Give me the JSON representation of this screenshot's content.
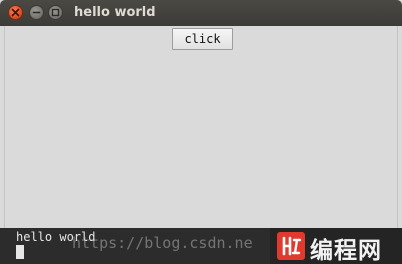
{
  "window": {
    "title": "hello world",
    "controls": {
      "close_icon": "close-icon",
      "minimize_icon": "minimize-icon",
      "maximize_icon": "maximize-icon"
    }
  },
  "content": {
    "button_label": "click"
  },
  "terminal": {
    "output_line": "hello world"
  },
  "watermark": {
    "url": "https://blog.csdn.ne",
    "logo_text": "编程网"
  },
  "colors": {
    "titlebar": "#3c3b37",
    "title_text": "#dfdbd2",
    "close_button": "#e0502a",
    "window_bg": "#dadada",
    "terminal_bg": "#2c2c2c",
    "logo_red": "#e03a2e"
  }
}
